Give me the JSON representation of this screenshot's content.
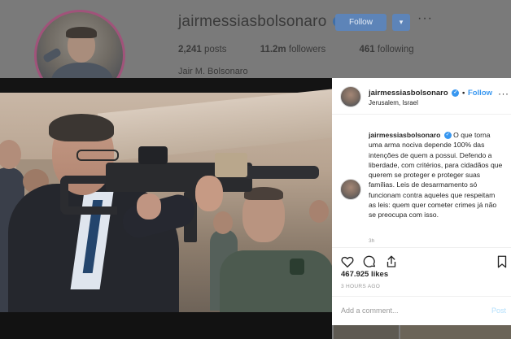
{
  "profile": {
    "username": "jairmessiasbolsonaro",
    "follow_label": "Follow",
    "dropdown_glyph": "▾",
    "more_glyph": "···",
    "posts_count": "2,241",
    "posts_label": "posts",
    "followers_count": "11.2m",
    "followers_label": "followers",
    "following_count": "461",
    "following_label": "following",
    "full_name": "Jair M. Bolsonaro"
  },
  "post": {
    "username": "jairmessiasbolsonaro",
    "follow_label": "Follow",
    "dot": "•",
    "location": "Jerusalem, Israel",
    "more_glyph": "···",
    "caption_user": "jairmessiasbolsonaro",
    "caption_text": "O que torna uma arma nociva depende 100% das intenções de quem a possui. Defendo a liberdade, com critérios, para cidadãos que querem se proteger e proteger suas famílias. Leis de desarmamento só funcionam contra aqueles que respeitam as leis: quem quer cometer crimes já não se preocupa com isso.",
    "caption_age": "3h",
    "likes": "467.925 likes",
    "time_ago": "3 HOURS AGO",
    "comment_placeholder": "Add a comment...",
    "post_label": "Post"
  },
  "icons": {
    "verified": "verified-badge-icon",
    "like": "heart-icon",
    "comment": "comment-icon",
    "share": "share-icon",
    "save": "bookmark-icon"
  },
  "colors": {
    "instagram_blue": "#3897f0",
    "dimmed_follow": "#5d84b8",
    "overlay_bg": "#7a7a7a"
  }
}
